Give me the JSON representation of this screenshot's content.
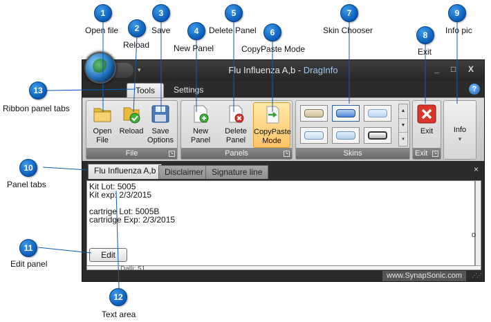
{
  "window": {
    "title_doc": "Flu Influenza A,b",
    "title_sep": " - ",
    "title_app": "DragInfo",
    "minimize": "_",
    "maximize": "□",
    "close": "X",
    "qat_arrow": "▾"
  },
  "ribbon_tabs": [
    "Tools",
    "Settings"
  ],
  "help_label": "?",
  "groups": {
    "file": {
      "label": "File",
      "buttons": [
        "Open\nFile",
        "Reload",
        "Save\nOptions"
      ]
    },
    "panels": {
      "label": "Panels",
      "buttons": [
        "New Panel",
        "Delete\nPanel",
        "CopyPaste\nMode"
      ]
    },
    "skins": {
      "label": "Skins"
    },
    "exit": {
      "label": "Exit",
      "button": "Exit"
    },
    "info": {
      "button": "Info",
      "dropdown": "▾"
    }
  },
  "panel_tabs": [
    "Flu Influenza A,b",
    "Disclaimer",
    "Signature line"
  ],
  "panel_close": "×",
  "text_area_lines": [
    "Kit Lot: 5005",
    "Kit exp: 2/3/2015",
    "",
    "cartrige Lot: 5005B",
    "cartridge Exp: 2/3/2015"
  ],
  "edit_button": "Edit",
  "partial_text": "Dalli: 51",
  "status_text": "www.SynapSonic.com",
  "outside_glyph": "o",
  "callouts": [
    {
      "num": "1",
      "label": "Open file"
    },
    {
      "num": "2",
      "label": "Reload"
    },
    {
      "num": "3",
      "label": "Save"
    },
    {
      "num": "4",
      "label": "New Panel"
    },
    {
      "num": "5",
      "label": "Delete Panel"
    },
    {
      "num": "6",
      "label": "CopyPaste Mode"
    },
    {
      "num": "7",
      "label": "Skin Chooser"
    },
    {
      "num": "8",
      "label": "Exit"
    },
    {
      "num": "9",
      "label": "Info pic"
    },
    {
      "num": "10",
      "label": "Panel tabs"
    },
    {
      "num": "11",
      "label": "Edit panel"
    },
    {
      "num": "12",
      "label": "Text area"
    },
    {
      "num": "13",
      "label": "Ribbon panel tabs"
    }
  ],
  "colors": {
    "callout_blue": "#0a5cb8",
    "window_dark": "#2b2b2b",
    "title_accent": "#9ec6f0",
    "copypaste_highlight": "#ffc36a",
    "exit_red": "#d9352c"
  }
}
